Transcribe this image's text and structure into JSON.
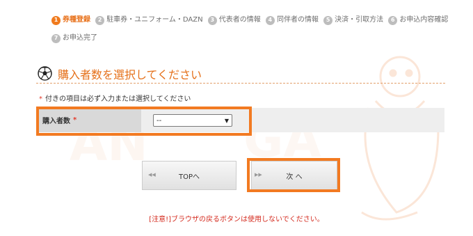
{
  "steps": [
    {
      "num": "1",
      "label": "券種登録",
      "active": true
    },
    {
      "num": "2",
      "label": "駐車券・ユニフォーム・DAZN",
      "active": false
    },
    {
      "num": "3",
      "label": "代表者の情報",
      "active": false
    },
    {
      "num": "4",
      "label": "同伴者の情報",
      "active": false
    },
    {
      "num": "5",
      "label": "決済・引取方法",
      "active": false
    },
    {
      "num": "6",
      "label": "お申込内容確認",
      "active": false
    },
    {
      "num": "7",
      "label": "お申込完了",
      "active": false
    }
  ],
  "section": {
    "title": "購入者数を選択してください",
    "icon": "soccer-ball-icon"
  },
  "form": {
    "required_marker": "*",
    "required_note": "付きの項目は必ず入力または選択してください",
    "purchaser_count_label": "購入者数",
    "purchaser_count_value": "--"
  },
  "buttons": {
    "top_label": "TOPへ",
    "next_label": "次 へ"
  },
  "warning": "[注意!]ブラウザの戻るボタンは使用しないでください。",
  "colors": {
    "accent": "#f27a21",
    "heading": "#e5701a",
    "warning": "#d42a1e",
    "required": "#e33a2b"
  }
}
